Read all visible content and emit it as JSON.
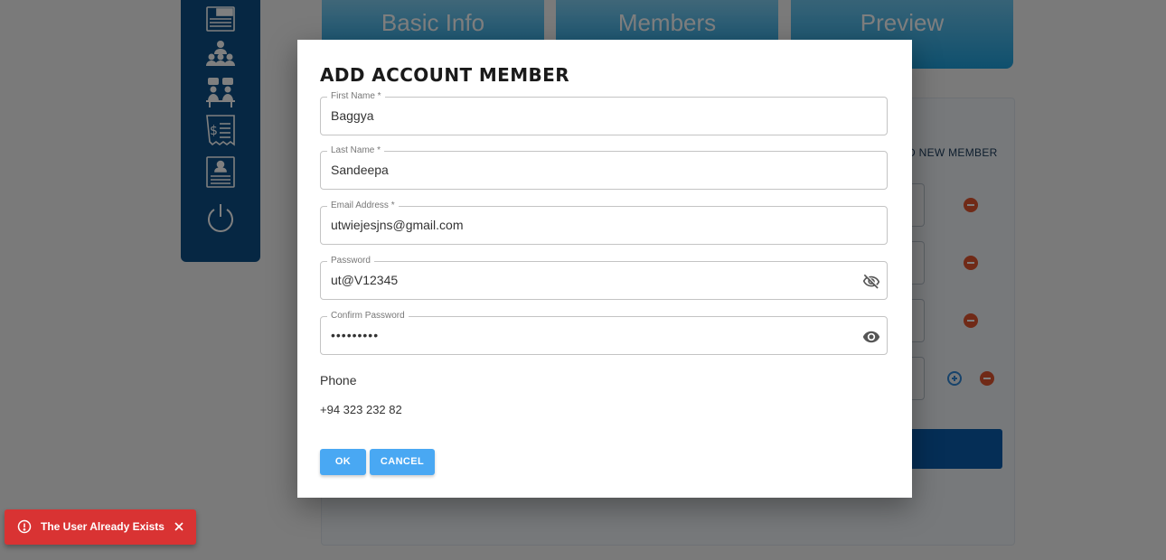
{
  "tabs": [
    {
      "label": "Basic Info"
    },
    {
      "label": "Members"
    },
    {
      "label": "Preview"
    }
  ],
  "sidebar": {
    "icons": [
      "jobs-icon",
      "team-icon",
      "meeting-icon",
      "billing-icon",
      "profile-document-icon",
      "power-icon"
    ]
  },
  "background": {
    "add_new_member_label": "D NEW MEMBER"
  },
  "dialog": {
    "title": "ADD ACCOUNT MEMBER",
    "fields": {
      "first_name": {
        "label": "First Name *",
        "value": "Baggya"
      },
      "last_name": {
        "label": "Last Name *",
        "value": "Sandeepa"
      },
      "email": {
        "label": "Email Address *",
        "value": "utwiejesjns@gmail.com"
      },
      "password": {
        "label": "Password",
        "value": "ut@V12345",
        "toggle_icon": "eye-off-icon"
      },
      "confirm_password": {
        "label": "Confirm Password",
        "value": "•••••••••",
        "toggle_icon": "eye-icon"
      }
    },
    "phone": {
      "label": "Phone",
      "value": "+94 323 232 82"
    },
    "buttons": {
      "ok": "OK",
      "cancel": "CANCEL"
    }
  },
  "toast": {
    "message": "The User Already Exists",
    "icon": "error-icon",
    "close_icon": "close-icon",
    "color": "#d93333"
  },
  "colors": {
    "primary_button": "#49a8f3",
    "sidebar": "#0c4f86",
    "toast_error": "#d93333"
  }
}
